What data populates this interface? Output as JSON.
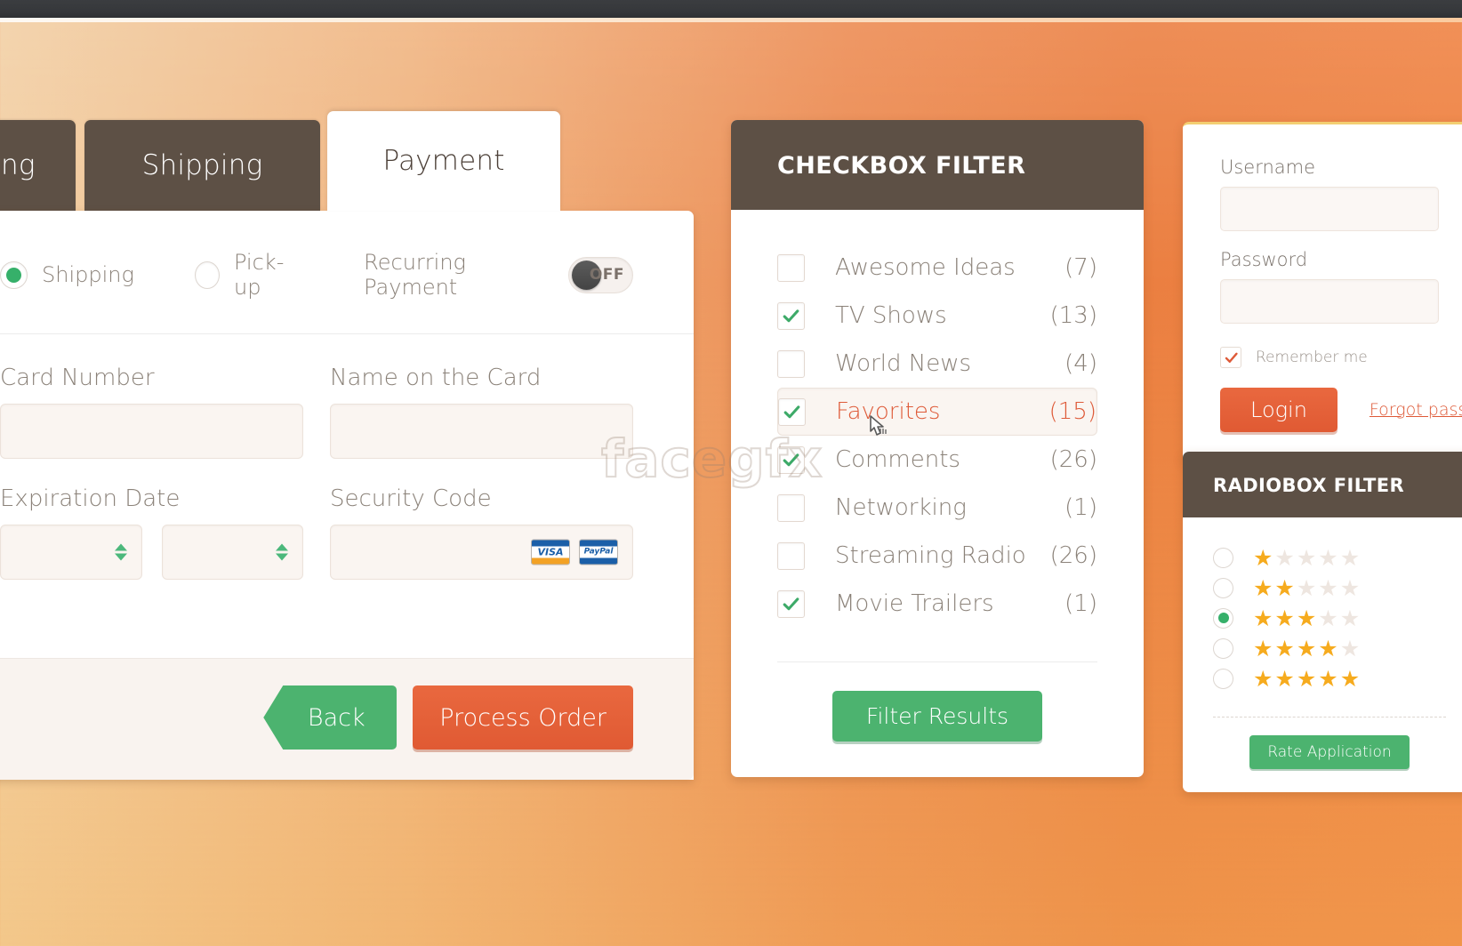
{
  "theme": {
    "accent_orange": "#e05a33",
    "accent_green": "#4cb36f",
    "panel_header_brown": "#5d5045",
    "star_gold": "#f6ab1e",
    "muted_text": "#8b8279"
  },
  "watermark": {
    "text": "facegfx"
  },
  "checkout": {
    "tabs": [
      {
        "label": "Billing",
        "active": false
      },
      {
        "label": "Shipping",
        "active": false
      },
      {
        "label": "Payment",
        "active": true
      }
    ],
    "delivery_options": [
      {
        "label": "Shipping",
        "selected": true
      },
      {
        "label": "Pick-up",
        "selected": false
      }
    ],
    "recurring": {
      "label": "Recurring Payment",
      "state": "OFF"
    },
    "fields": {
      "card_number_label": "Card Number",
      "card_number_value": "",
      "name_on_card_label": "Name on the Card",
      "name_on_card_value": "",
      "expiration_label": "Expiration Date",
      "expiration_month_value": "",
      "expiration_year_value": "",
      "security_code_label": "Security Code",
      "security_code_value": ""
    },
    "card_marks": [
      {
        "name": "visa-logo",
        "text": "VISA"
      },
      {
        "name": "paypal-logo",
        "text": "PayPal"
      }
    ],
    "buttons": {
      "back": "Back",
      "process": "Process Order"
    }
  },
  "checkbox_filter": {
    "title": "CHECKBOX FILTER",
    "items": [
      {
        "label": "Awesome Ideas",
        "count": "(7)",
        "checked": false,
        "highlight": false
      },
      {
        "label": "TV Shows",
        "count": "(13)",
        "checked": true,
        "highlight": false
      },
      {
        "label": "World News",
        "count": "(4)",
        "checked": false,
        "highlight": false
      },
      {
        "label": "Favorites",
        "count": "(15)",
        "checked": true,
        "highlight": true
      },
      {
        "label": "Comments",
        "count": "(26)",
        "checked": true,
        "highlight": false
      },
      {
        "label": "Networking",
        "count": "(1)",
        "checked": false,
        "highlight": false
      },
      {
        "label": "Streaming Radio",
        "count": "(26)",
        "checked": false,
        "highlight": false
      },
      {
        "label": "Movie Trailers",
        "count": "(1)",
        "checked": true,
        "highlight": false
      }
    ],
    "button": "Filter Results"
  },
  "login": {
    "username_label": "Username",
    "username_value": "",
    "password_label": "Password",
    "password_value": "",
    "remember_label": "Remember me",
    "remember_checked": true,
    "login_button": "Login",
    "forgot_link": "Forgot password?"
  },
  "radiobox_filter": {
    "title": "RADIOBOX FILTER",
    "options": [
      {
        "stars": 1,
        "selected": false
      },
      {
        "stars": 2,
        "selected": false
      },
      {
        "stars": 3,
        "selected": true
      },
      {
        "stars": 4,
        "selected": false
      },
      {
        "stars": 5,
        "selected": false
      }
    ],
    "max_stars": 5,
    "button": "Rate Application"
  }
}
